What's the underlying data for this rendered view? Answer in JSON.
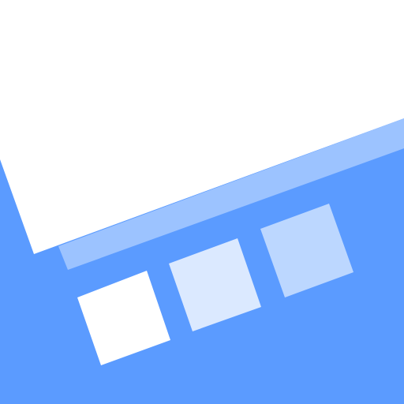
{
  "colors": {
    "background_blue": "#5b9bff",
    "white_panel": "#ffffff",
    "light_band": "#9cc3ff",
    "tile_white": "#ffffff",
    "tile_pale_blue": "#dbe9ff",
    "tile_light_blue": "#bcd7ff"
  },
  "icons": {
    "main_shape": "tilted-panel-icon",
    "tiles": [
      "square-tile-icon",
      "square-tile-icon",
      "square-tile-icon"
    ]
  }
}
